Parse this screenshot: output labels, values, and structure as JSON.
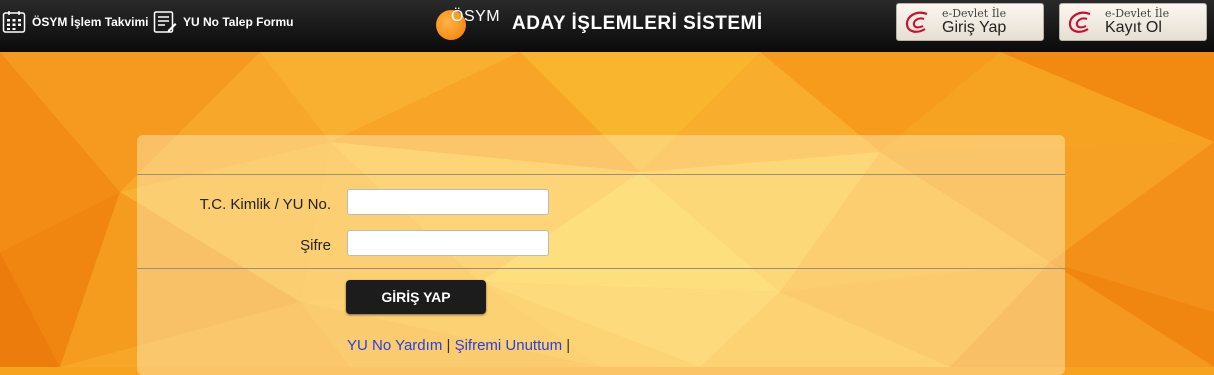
{
  "nav": {
    "calendar_label": "ÖSYM İşlem Takvimi",
    "calendar_icon": "calendar-icon",
    "form_label": "YU No Talep Formu",
    "form_icon": "list-form-icon"
  },
  "brand": {
    "logo_text": "ÖSYM",
    "title": "ADAY İŞLEMLERİ SİSTEMİ"
  },
  "edevlet": {
    "login_small": "e-Devlet İle",
    "login_big": "Giriş Yap",
    "register_small": "e-Devlet İle",
    "register_big": "Kayıt Ol",
    "icon": "edevlet-logo-icon",
    "logo_color": "#c8102e"
  },
  "form": {
    "id_label": "T.C. Kimlik / YU No.",
    "id_value": "",
    "password_label": "Şifre",
    "password_value": "",
    "submit_label": "GİRİŞ YAP"
  },
  "links": {
    "help": "YU No Yardım",
    "separator": "|",
    "forgot": "Şifremi Unuttum"
  },
  "colors": {
    "accent": "#f7a31f",
    "link": "#2b3ee0"
  }
}
